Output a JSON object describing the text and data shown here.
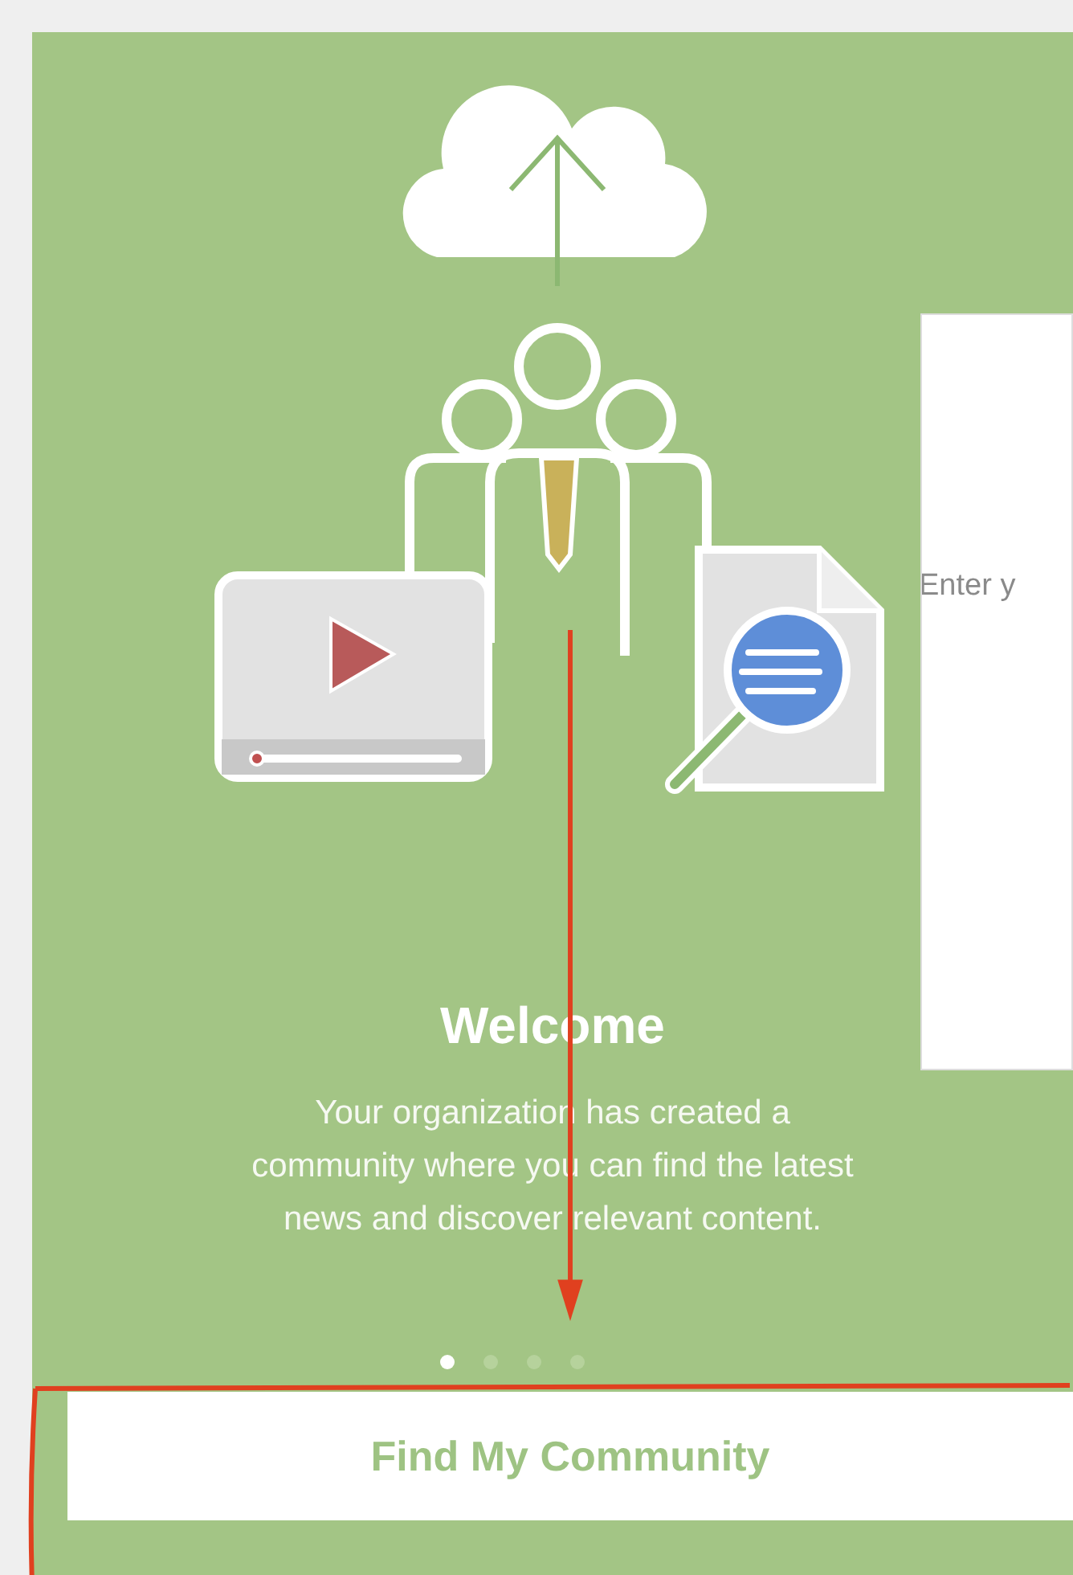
{
  "welcome": {
    "title": "Welcome",
    "body": "Your organization has created a community where you can find the latest news and discover relevant content."
  },
  "pager": [
    {
      "selected": true
    },
    {
      "selected": false
    },
    {
      "selected": false
    },
    {
      "selected": false
    }
  ],
  "button": {
    "label": "Find My Community"
  },
  "overlay_panel": {
    "text": "Enter y"
  }
}
